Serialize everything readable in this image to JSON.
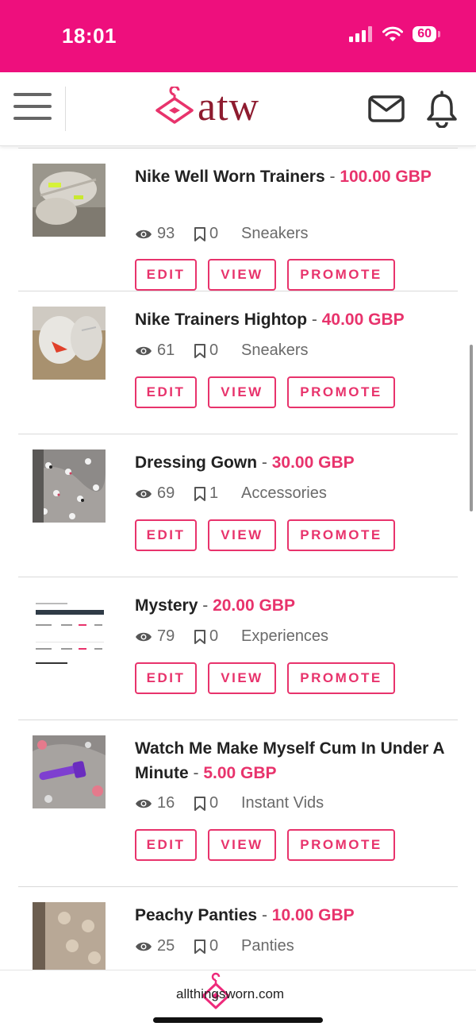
{
  "status": {
    "time": "18:01",
    "battery": "60"
  },
  "header": {
    "logo_text": "atw"
  },
  "listings": [
    {
      "title": "Nike Well Worn Trainers",
      "price": "100.00 GBP",
      "views": "93",
      "saves": "0",
      "category": "Sneakers",
      "edit": "EDIT",
      "view": "VIEW",
      "promote": "PROMOTE"
    },
    {
      "title": "Nike Trainers Hightop",
      "price": "40.00 GBP",
      "views": "61",
      "saves": "0",
      "category": "Sneakers",
      "edit": "EDIT",
      "view": "VIEW",
      "promote": "PROMOTE"
    },
    {
      "title": "Dressing Gown",
      "price": "30.00 GBP",
      "views": "69",
      "saves": "1",
      "category": "Accessories",
      "edit": "EDIT",
      "view": "VIEW",
      "promote": "PROMOTE"
    },
    {
      "title": "Mystery",
      "price": "20.00 GBP",
      "views": "79",
      "saves": "0",
      "category": "Experiences",
      "edit": "EDIT",
      "view": "VIEW",
      "promote": "PROMOTE"
    },
    {
      "title": "Watch Me Make Myself Cum In Under A Minute",
      "price": "5.00 GBP",
      "views": "16",
      "saves": "0",
      "category": "Instant Vids",
      "edit": "EDIT",
      "view": "VIEW",
      "promote": "PROMOTE"
    },
    {
      "title": "Peachy Panties",
      "price": "10.00 GBP",
      "views": "25",
      "saves": "0",
      "category": "Panties"
    }
  ],
  "footer": {
    "site": "allthingsworn.com"
  },
  "colors": {
    "brand_pink": "#ee0f7d",
    "price": "#e8336c",
    "logo": "#8e1b2f"
  }
}
